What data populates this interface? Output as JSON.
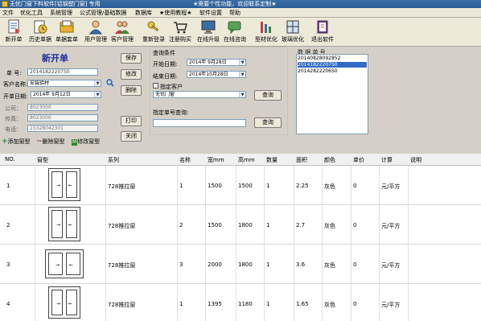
{
  "title_bar": {
    "app_title": "无忧门窗下料软件[铝钢塑门窗] 专用",
    "marquee": "★需要个性功能，欢迎联系定制★"
  },
  "menu": [
    "文件",
    "优化工具",
    "系统管理",
    "公式管理/基础数据",
    "数据库",
    "★使用教程★",
    "软件设置",
    "帮助"
  ],
  "toolbar": [
    {
      "label": "新开单",
      "icon": "document-icon"
    },
    {
      "label": "历史单据",
      "icon": "history-icon"
    },
    {
      "label": "单据套单",
      "icon": "folder-icon"
    },
    {
      "label": "用户管理",
      "icon": "user-icon"
    },
    {
      "label": "客户管理",
      "icon": "customer-icon"
    },
    {
      "label": "重新登录",
      "icon": "key-icon"
    },
    {
      "label": "注册购买",
      "icon": "cart-icon"
    },
    {
      "label": "在线升级",
      "icon": "monitor-icon"
    },
    {
      "label": "在线咨询",
      "icon": "chat-icon"
    },
    {
      "label": "型材优化",
      "icon": "bars-icon"
    },
    {
      "label": "玻璃优化",
      "icon": "glass-icon"
    },
    {
      "label": "退出软件",
      "icon": "exit-icon"
    }
  ],
  "form": {
    "heading": "新开单",
    "order_no_label": "单    号:",
    "order_no": "20141822207S0",
    "customer_label": "客户名称:",
    "customer": "安装铝材",
    "date_label": "开单日期:",
    "date": "2014年  9月12日",
    "company_label": "公司：",
    "company": "8023000",
    "fax_label": "传真：",
    "fax": "8023000",
    "phone_label": "电话：",
    "phone": "15328042301"
  },
  "side_buttons": {
    "save": "保存",
    "modify": "修改",
    "delete": "删除",
    "print": "打印",
    "close": "关闭"
  },
  "add_row_buttons": {
    "add": "添加窗型",
    "remove": "删除窗型",
    "edit": "修改窗型"
  },
  "query": {
    "title": "查询条件",
    "start_label": "开始日期:",
    "start": "2014年  9月28日",
    "end_label": "结束日期:",
    "end": "2014年10月28日",
    "customer_checkbox": "指定客户",
    "customer_select": "无忧门窗",
    "query_button": "查询",
    "order_query_label": "指定单号查询:",
    "order_query_value": "",
    "order_query_button": "查询"
  },
  "data_list": {
    "title": "数  据  单  号",
    "items": [
      "20140828092852",
      "20141822207S0",
      "20142822206S0"
    ],
    "selected_index": 1
  },
  "grid": {
    "headers": [
      "NO.",
      "窗型",
      "系列",
      "名称",
      "宽mm",
      "高mm",
      "数量",
      "面积",
      "颜色",
      "单价",
      "计算",
      "说明"
    ],
    "rows": [
      {
        "no": "1",
        "series": "728推拉窗",
        "name": "1",
        "width": "1500",
        "height": "1500",
        "qty": "1",
        "area": "2.25",
        "color": "灰色",
        "price": "0",
        "calc": "元/平方"
      },
      {
        "no": "2",
        "series": "728推拉窗",
        "name": "2",
        "width": "1500",
        "height": "1800",
        "qty": "1",
        "area": "2.7",
        "color": "灰色",
        "price": "0",
        "calc": "元/平方"
      },
      {
        "no": "3",
        "series": "728推拉窗",
        "name": "3",
        "width": "2000",
        "height": "1800",
        "qty": "1",
        "area": "3.6",
        "color": "灰色",
        "price": "0",
        "calc": "元/平方"
      },
      {
        "no": "4",
        "series": "728推拉窗",
        "name": "1",
        "width": "1395",
        "height": "1180",
        "qty": "1",
        "area": "1.65",
        "color": "灰色",
        "price": "0",
        "calc": "元/平方"
      }
    ]
  },
  "colors": {
    "title_bar": "#2a5a94",
    "heading": "#1f2a9c",
    "selection": "#316ac5"
  }
}
